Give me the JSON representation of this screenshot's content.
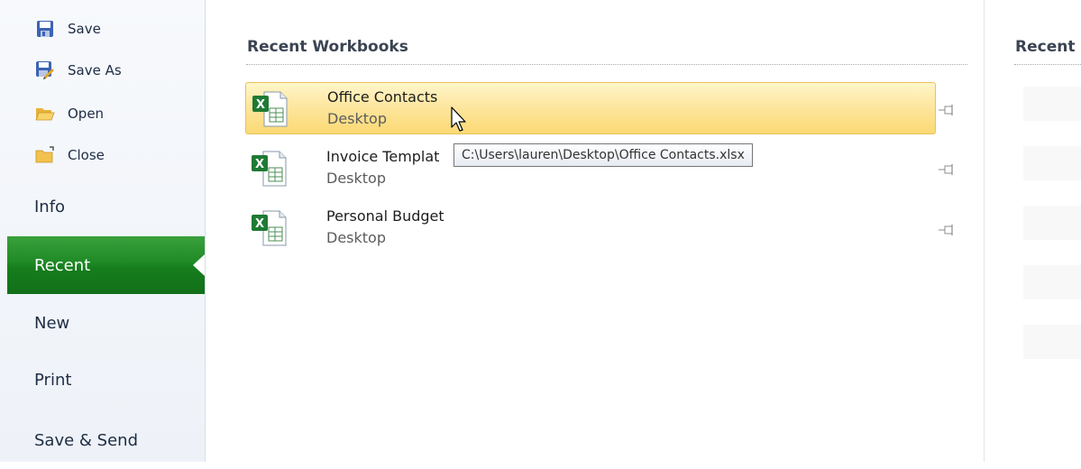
{
  "nav": {
    "commands": [
      {
        "label": "Save",
        "icon": "save-icon"
      },
      {
        "label": "Save As",
        "icon": "save-as-icon"
      },
      {
        "label": "Open",
        "icon": "open-folder-icon"
      },
      {
        "label": "Close",
        "icon": "close-folder-icon"
      }
    ],
    "tabs": [
      {
        "label": "Info"
      },
      {
        "label": "Recent",
        "active": true
      },
      {
        "label": "New"
      },
      {
        "label": "Print"
      },
      {
        "label": "Save & Send"
      }
    ]
  },
  "recent": {
    "title": "Recent Workbooks",
    "items": [
      {
        "name": "Office Contacts",
        "location": "Desktop",
        "icon": "excel-workbook-icon",
        "hovered": true
      },
      {
        "name": "Invoice Templat",
        "location": "Desktop",
        "icon": "excel-workbook-icon"
      },
      {
        "name": "Personal Budget",
        "location": "Desktop",
        "icon": "excel-workbook-icon"
      }
    ],
    "tooltip": "C:\\Users\\lauren\\Desktop\\Office Contacts.xlsx"
  },
  "recent_places": {
    "title": "Recent"
  },
  "colors": {
    "active_tab": "#1f8a26",
    "hover_row": "#fde59c",
    "hover_border": "#e9c25c"
  }
}
